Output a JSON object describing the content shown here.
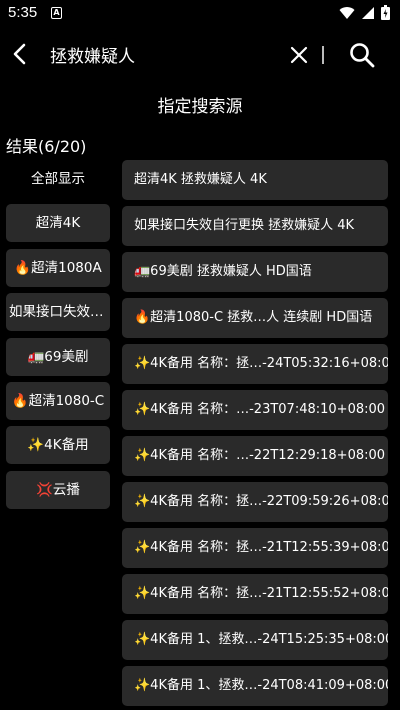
{
  "status": {
    "time": "5:35",
    "notification_letter": "A"
  },
  "search": {
    "query": "拯救嫌疑人"
  },
  "source_title": "指定搜索源",
  "result_count": "结果(6/20)",
  "sidebar": {
    "all_label": "全部显示",
    "items": [
      {
        "label": "超清4K"
      },
      {
        "label": "🔥超清1080A"
      },
      {
        "label": "如果接口失效自.."
      },
      {
        "label": "🚛69美剧"
      },
      {
        "label": "🔥超清1080-C"
      },
      {
        "label": "✨4K备用"
      },
      {
        "label": "💢云播"
      }
    ]
  },
  "results": [
    {
      "label": "超清4K  拯救嫌疑人  4K"
    },
    {
      "label": "如果接口失效自行更换  拯救嫌疑人  4K"
    },
    {
      "label": "🚛69美剧  拯救嫌疑人  HD国语"
    },
    {
      "label": "🔥超清1080-C  拯救…人 连续剧 HD国语"
    },
    {
      "label": "✨4K备用  名称：拯…-24T05:32:16+08:00"
    },
    {
      "label": "✨4K备用  名称：…-23T07:48:10+08:00"
    },
    {
      "label": "✨4K备用  名称：…-22T12:29:18+08:00"
    },
    {
      "label": "✨4K备用  名称：拯…-22T09:59:26+08:00"
    },
    {
      "label": "✨4K备用  名称：拯…-21T12:55:39+08:00"
    },
    {
      "label": "✨4K备用  名称：拯…-21T12:55:52+08:00"
    },
    {
      "label": "✨4K备用  1、拯救…-24T15:25:35+08:00"
    },
    {
      "label": "✨4K备用  1、拯救…-24T08:41:09+08:00"
    }
  ]
}
